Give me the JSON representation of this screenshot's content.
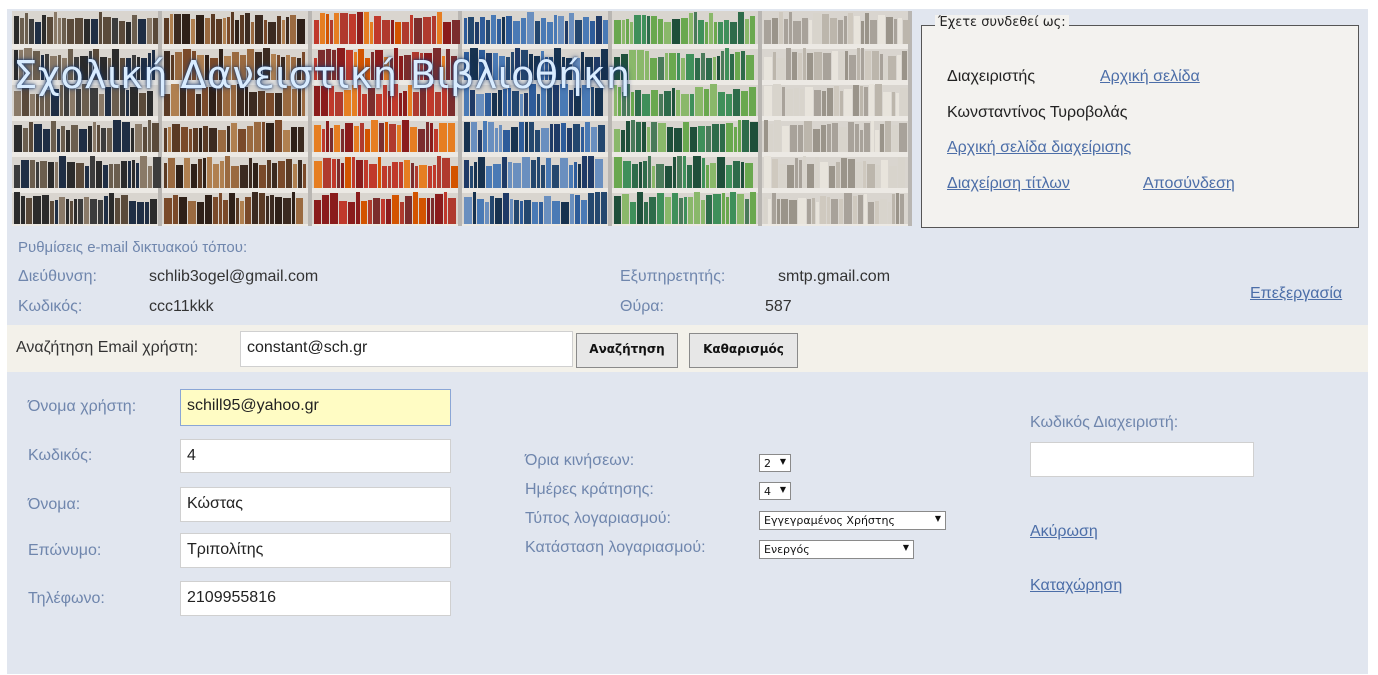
{
  "banner": {
    "title": "Σχολική Δανειστική Βιβλιοθήκη"
  },
  "login": {
    "legend": "Έχετε συνδεθεί ως:",
    "role": "Διαχειριστής",
    "home_link": "Αρχική σελίδα",
    "user_name": "Κωνσταντίνος Τυροβολάς",
    "admin_home_link": "Αρχική σελίδα διαχείρισης",
    "titles_link": "Διαχείριση τίτλων",
    "logout_link": "Αποσύνδεση"
  },
  "email_settings": {
    "heading": "Ρυθμίσεις e-mail δικτυακού τόπου:",
    "address_label": "Διεύθυνση:",
    "address_value": "schlib3ogel@gmail.com",
    "password_label": "Κωδικός:",
    "password_value": "ccc11kkk",
    "server_label": "Εξυπηρετητής:",
    "server_value": "smtp.gmail.com",
    "port_label": "Θύρα:",
    "port_value": "587",
    "edit_link": "Επεξεργασία"
  },
  "search": {
    "label": "Αναζήτηση Email χρήστη:",
    "value": "constant@sch.gr",
    "search_button": "Αναζήτηση",
    "clear_button": "Καθαρισμός"
  },
  "form": {
    "username_label": "Όνομα χρήστη:",
    "username_value": "schill95@yahoo.gr",
    "password_label": "Κωδικός:",
    "password_value": "4",
    "firstname_label": "Όνομα:",
    "firstname_value": "Κώστας",
    "lastname_label": "Επώνυμο:",
    "lastname_value": "Τριπολίτης",
    "phone_label": "Τηλέφωνο:",
    "phone_value": "2109955816",
    "limits_label": "Όρια κινήσεων:",
    "limits_value": "2",
    "days_label": "Ημέρες κράτησης:",
    "days_value": "4",
    "account_type_label": "Τύπος λογαριασμού:",
    "account_type_value": "Εγγεγραμένος Χρήστης",
    "account_status_label": "Κατάσταση λογαριασμού:",
    "account_status_value": "Ενεργός",
    "admin_code_label": "Κωδικός Διαχειριστή:",
    "admin_code_value": "",
    "cancel_link": "Ακύρωση",
    "submit_link": "Καταχώρηση"
  },
  "colors": {
    "page_bg": "#e1e6ef",
    "link": "#4c6ea8",
    "label": "#6f86ad",
    "search_bar_bg": "#f3f1ea",
    "highlight_input": "#fffcc4"
  },
  "icons": {
    "select_arrow": "▼"
  }
}
